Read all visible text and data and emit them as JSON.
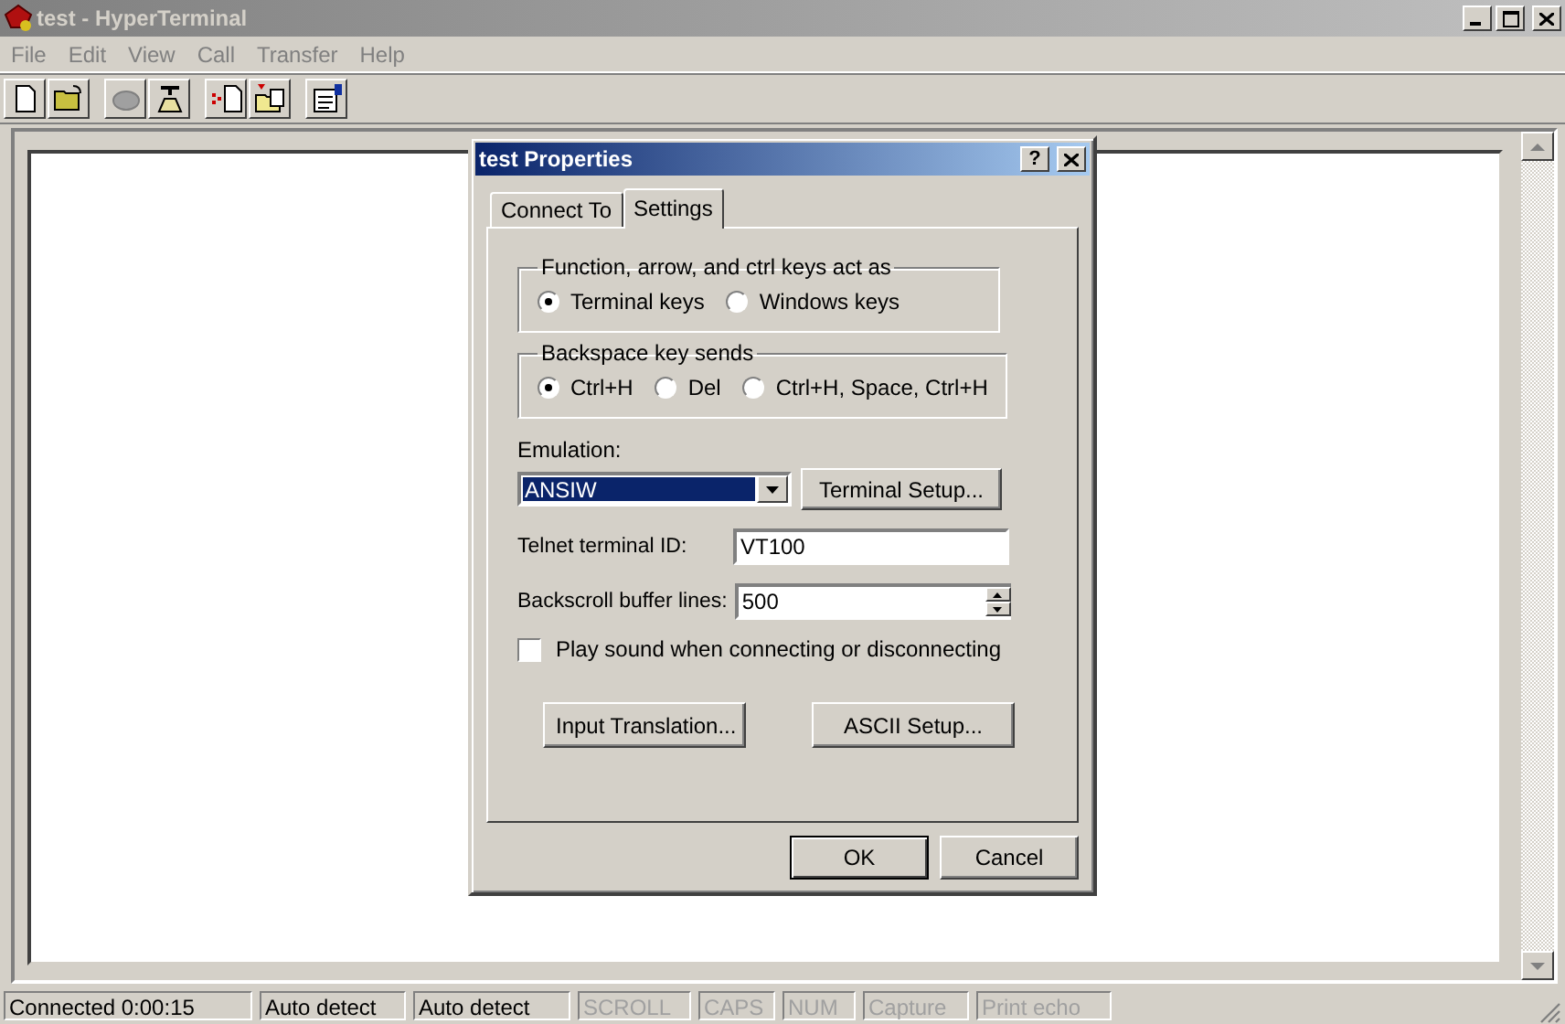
{
  "window": {
    "title": "test - HyperTerminal",
    "active": false
  },
  "menu": [
    "File",
    "Edit",
    "View",
    "Call",
    "Transfer",
    "Help"
  ],
  "dialog": {
    "title": "test Properties",
    "active": true,
    "help_button": "?",
    "tabs": [
      {
        "label": "Connect To",
        "selected": false
      },
      {
        "label": "Settings",
        "selected": true
      }
    ],
    "groups": [
      {
        "title": "Function, arrow, and ctrl keys act as",
        "options": [
          {
            "label": "Terminal keys",
            "selected": true
          },
          {
            "label": "Windows keys",
            "selected": false
          }
        ]
      },
      {
        "title": "Backspace key sends",
        "options": [
          {
            "label": "Ctrl+H",
            "selected": true
          },
          {
            "label": "Del",
            "selected": false
          },
          {
            "label": "Ctrl+H, Space, Ctrl+H",
            "selected": false
          }
        ]
      }
    ],
    "emulation": {
      "label": "Emulation:",
      "value": "ANSIW"
    },
    "terminal_setup_button": "Terminal Setup...",
    "telnet_id": {
      "label": "Telnet terminal ID:",
      "value": "VT100"
    },
    "backscroll": {
      "label": "Backscroll buffer lines:",
      "value": "500"
    },
    "play_sound": {
      "label": "Play sound when connecting or disconnecting",
      "checked": false
    },
    "buttons": [
      "Input Translation...",
      "ASCII Setup..."
    ],
    "footer_buttons": [
      "OK",
      "Cancel"
    ]
  },
  "status_bar": [
    {
      "text": "Connected 0:00:15",
      "disabled": false
    },
    {
      "text": "Auto detect",
      "disabled": false
    },
    {
      "text": "Auto detect",
      "disabled": false
    },
    {
      "text": "SCROLL",
      "disabled": true
    },
    {
      "text": "CAPS",
      "disabled": true
    },
    {
      "text": "NUM",
      "disabled": true
    },
    {
      "text": "Capture",
      "disabled": true
    },
    {
      "text": "Print echo",
      "disabled": true
    }
  ]
}
